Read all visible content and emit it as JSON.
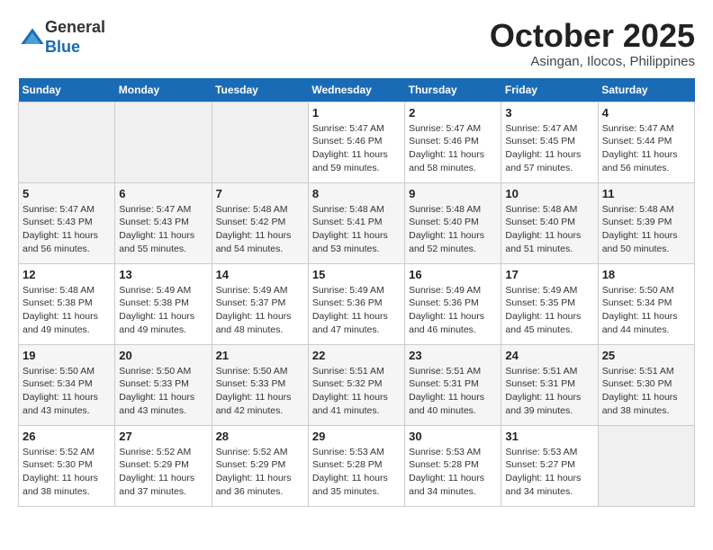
{
  "header": {
    "logo_line1": "General",
    "logo_line2": "Blue",
    "month": "October 2025",
    "location": "Asingan, Ilocos, Philippines"
  },
  "weekdays": [
    "Sunday",
    "Monday",
    "Tuesday",
    "Wednesday",
    "Thursday",
    "Friday",
    "Saturday"
  ],
  "weeks": [
    [
      {
        "day": "",
        "info": ""
      },
      {
        "day": "",
        "info": ""
      },
      {
        "day": "",
        "info": ""
      },
      {
        "day": "1",
        "info": "Sunrise: 5:47 AM\nSunset: 5:46 PM\nDaylight: 11 hours\nand 59 minutes."
      },
      {
        "day": "2",
        "info": "Sunrise: 5:47 AM\nSunset: 5:46 PM\nDaylight: 11 hours\nand 58 minutes."
      },
      {
        "day": "3",
        "info": "Sunrise: 5:47 AM\nSunset: 5:45 PM\nDaylight: 11 hours\nand 57 minutes."
      },
      {
        "day": "4",
        "info": "Sunrise: 5:47 AM\nSunset: 5:44 PM\nDaylight: 11 hours\nand 56 minutes."
      }
    ],
    [
      {
        "day": "5",
        "info": "Sunrise: 5:47 AM\nSunset: 5:43 PM\nDaylight: 11 hours\nand 56 minutes."
      },
      {
        "day": "6",
        "info": "Sunrise: 5:47 AM\nSunset: 5:43 PM\nDaylight: 11 hours\nand 55 minutes."
      },
      {
        "day": "7",
        "info": "Sunrise: 5:48 AM\nSunset: 5:42 PM\nDaylight: 11 hours\nand 54 minutes."
      },
      {
        "day": "8",
        "info": "Sunrise: 5:48 AM\nSunset: 5:41 PM\nDaylight: 11 hours\nand 53 minutes."
      },
      {
        "day": "9",
        "info": "Sunrise: 5:48 AM\nSunset: 5:40 PM\nDaylight: 11 hours\nand 52 minutes."
      },
      {
        "day": "10",
        "info": "Sunrise: 5:48 AM\nSunset: 5:40 PM\nDaylight: 11 hours\nand 51 minutes."
      },
      {
        "day": "11",
        "info": "Sunrise: 5:48 AM\nSunset: 5:39 PM\nDaylight: 11 hours\nand 50 minutes."
      }
    ],
    [
      {
        "day": "12",
        "info": "Sunrise: 5:48 AM\nSunset: 5:38 PM\nDaylight: 11 hours\nand 49 minutes."
      },
      {
        "day": "13",
        "info": "Sunrise: 5:49 AM\nSunset: 5:38 PM\nDaylight: 11 hours\nand 49 minutes."
      },
      {
        "day": "14",
        "info": "Sunrise: 5:49 AM\nSunset: 5:37 PM\nDaylight: 11 hours\nand 48 minutes."
      },
      {
        "day": "15",
        "info": "Sunrise: 5:49 AM\nSunset: 5:36 PM\nDaylight: 11 hours\nand 47 minutes."
      },
      {
        "day": "16",
        "info": "Sunrise: 5:49 AM\nSunset: 5:36 PM\nDaylight: 11 hours\nand 46 minutes."
      },
      {
        "day": "17",
        "info": "Sunrise: 5:49 AM\nSunset: 5:35 PM\nDaylight: 11 hours\nand 45 minutes."
      },
      {
        "day": "18",
        "info": "Sunrise: 5:50 AM\nSunset: 5:34 PM\nDaylight: 11 hours\nand 44 minutes."
      }
    ],
    [
      {
        "day": "19",
        "info": "Sunrise: 5:50 AM\nSunset: 5:34 PM\nDaylight: 11 hours\nand 43 minutes."
      },
      {
        "day": "20",
        "info": "Sunrise: 5:50 AM\nSunset: 5:33 PM\nDaylight: 11 hours\nand 43 minutes."
      },
      {
        "day": "21",
        "info": "Sunrise: 5:50 AM\nSunset: 5:33 PM\nDaylight: 11 hours\nand 42 minutes."
      },
      {
        "day": "22",
        "info": "Sunrise: 5:51 AM\nSunset: 5:32 PM\nDaylight: 11 hours\nand 41 minutes."
      },
      {
        "day": "23",
        "info": "Sunrise: 5:51 AM\nSunset: 5:31 PM\nDaylight: 11 hours\nand 40 minutes."
      },
      {
        "day": "24",
        "info": "Sunrise: 5:51 AM\nSunset: 5:31 PM\nDaylight: 11 hours\nand 39 minutes."
      },
      {
        "day": "25",
        "info": "Sunrise: 5:51 AM\nSunset: 5:30 PM\nDaylight: 11 hours\nand 38 minutes."
      }
    ],
    [
      {
        "day": "26",
        "info": "Sunrise: 5:52 AM\nSunset: 5:30 PM\nDaylight: 11 hours\nand 38 minutes."
      },
      {
        "day": "27",
        "info": "Sunrise: 5:52 AM\nSunset: 5:29 PM\nDaylight: 11 hours\nand 37 minutes."
      },
      {
        "day": "28",
        "info": "Sunrise: 5:52 AM\nSunset: 5:29 PM\nDaylight: 11 hours\nand 36 minutes."
      },
      {
        "day": "29",
        "info": "Sunrise: 5:53 AM\nSunset: 5:28 PM\nDaylight: 11 hours\nand 35 minutes."
      },
      {
        "day": "30",
        "info": "Sunrise: 5:53 AM\nSunset: 5:28 PM\nDaylight: 11 hours\nand 34 minutes."
      },
      {
        "day": "31",
        "info": "Sunrise: 5:53 AM\nSunset: 5:27 PM\nDaylight: 11 hours\nand 34 minutes."
      },
      {
        "day": "",
        "info": ""
      }
    ]
  ]
}
